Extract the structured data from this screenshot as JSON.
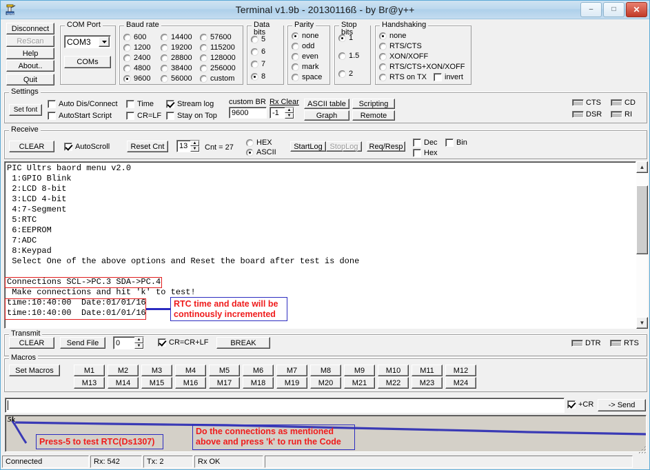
{
  "window": {
    "title": "Terminal v1.9b - 20130116ß - by Br@y++",
    "icon": "terminal-app-icon",
    "minimize": "–",
    "maximize": "□",
    "close": "✕"
  },
  "left_buttons": [
    {
      "name": "disconnect",
      "label": "Disconnect",
      "disabled": false
    },
    {
      "name": "rescan",
      "label": "ReScan",
      "disabled": true
    },
    {
      "name": "help",
      "label": "Help",
      "disabled": false
    },
    {
      "name": "about",
      "label": "About..",
      "disabled": false
    },
    {
      "name": "quit",
      "label": "Quit",
      "disabled": false
    }
  ],
  "com_port": {
    "caption": "COM Port",
    "selected": "COM3",
    "coms_button": "COMs"
  },
  "baud_rate": {
    "caption": "Baud rate",
    "selected": "9600",
    "col1": [
      "600",
      "1200",
      "2400",
      "4800",
      "9600"
    ],
    "col2": [
      "14400",
      "19200",
      "28800",
      "38400",
      "56000"
    ],
    "col3": [
      "57600",
      "115200",
      "128000",
      "256000",
      "custom"
    ]
  },
  "data_bits": {
    "caption": "Data bits",
    "selected": "8",
    "options": [
      "5",
      "6",
      "7",
      "8"
    ]
  },
  "parity": {
    "caption": "Parity",
    "selected": "none",
    "options": [
      "none",
      "odd",
      "even",
      "mark",
      "space"
    ]
  },
  "stop_bits": {
    "caption": "Stop bits",
    "selected": "1",
    "options": [
      "1",
      "1.5",
      "2"
    ]
  },
  "handshaking": {
    "caption": "Handshaking",
    "selected": "none",
    "options": [
      "none",
      "RTS/CTS",
      "XON/XOFF",
      "RTS/CTS+XON/XOFF",
      "RTS on TX"
    ],
    "invert_label": "invert",
    "invert_checked": false
  },
  "settings": {
    "caption": "Settings",
    "set_font": "Set font",
    "auto_dis_connect": {
      "label": "Auto Dis/Connect",
      "checked": false
    },
    "autostart_script": {
      "label": "AutoStart Script",
      "checked": false
    },
    "time": {
      "label": "Time",
      "checked": false
    },
    "cr_lf": {
      "label": "CR=LF",
      "checked": false
    },
    "stream_log": {
      "label": "Stream log",
      "checked": true
    },
    "stay_on_top": {
      "label": "Stay on Top",
      "checked": false
    },
    "custom_br_label": "custom BR",
    "custom_br_value": "9600",
    "rx_clear_label": "Rx Clear",
    "rx_clear_value": "-1",
    "ascii_table": "ASCII table",
    "scripting": "Scripting",
    "graph": "Graph",
    "remote": "Remote",
    "leds": [
      "CTS",
      "CD",
      "DSR",
      "RI"
    ]
  },
  "receive": {
    "caption": "Receive",
    "clear": "CLEAR",
    "autoscroll": {
      "label": "AutoScroll",
      "checked": true
    },
    "reset_cnt": "Reset Cnt",
    "spin_value": "13",
    "cnt_label": "Cnt = 27",
    "hex_radio": "HEX",
    "ascii_radio": "ASCII",
    "mode_selected": "ASCII",
    "startlog": "StartLog",
    "stoplog": "StopLog",
    "req_resp": "Req/Resp",
    "dec": {
      "label": "Dec",
      "checked": false
    },
    "bin": {
      "label": "Bin",
      "checked": false
    },
    "hex": {
      "label": "Hex",
      "checked": false
    }
  },
  "terminal": {
    "lines": "PIC Ultrs baord menu v2.0\n 1:GPIO Blink\n 2:LCD 8-bit\n 3:LCD 4-bit\n 4:7-Segment\n 5:RTC\n 6:EEPROM\n 7:ADC\n 8:Keypad\n Select One of the above options and Reset the board after test is done\n\nConnections SCL->PC.3 SDA->PC.4\n Make connections and hit 'k' to test!\ntime:10:40:00  Date:01/01/16\ntime:10:40:00  Date:01/01/16"
  },
  "transmit": {
    "caption": "Transmit",
    "clear": "CLEAR",
    "send_file": "Send File",
    "spin_value": "0",
    "cr_crlf": {
      "label": "CR=CR+LF",
      "checked": true
    },
    "break": "BREAK",
    "leds": [
      "DTR",
      "RTS"
    ]
  },
  "macros": {
    "caption": "Macros",
    "set_macros": "Set Macros",
    "row1": [
      "M1",
      "M2",
      "M3",
      "M4",
      "M5",
      "M6",
      "M7",
      "M8",
      "M9",
      "M10",
      "M11",
      "M12"
    ],
    "row2": [
      "M13",
      "M14",
      "M15",
      "M16",
      "M17",
      "M18",
      "M19",
      "M20",
      "M21",
      "M22",
      "M23",
      "M24"
    ]
  },
  "send_row": {
    "input_value": "",
    "plus_cr": {
      "label": "+CR",
      "checked": true
    },
    "send_button": "-> Send"
  },
  "graph": {
    "ylabel": "5k"
  },
  "annotations": [
    {
      "name": "rtc-time-annotation",
      "text": "RTC time and date will be continously incremented"
    },
    {
      "name": "press-5-annotation",
      "text": "Press-5 to test RTC(Ds1307)"
    },
    {
      "name": "connections-annotation",
      "text": "Do the connections as mentioned above and press 'k' to run the Code"
    }
  ],
  "statusbar": {
    "connection": "Connected",
    "rx": "Rx: 542",
    "tx": "Tx: 2",
    "rx_state": "Rx OK",
    "extra": ""
  },
  "colors": {
    "annotation_text": "#ef1c1c",
    "annotation_border": "#2b2bc0",
    "highlight_box": "#e01b1b",
    "graph_line": "#3a3ab5",
    "titlebar": "#aed0ea"
  }
}
